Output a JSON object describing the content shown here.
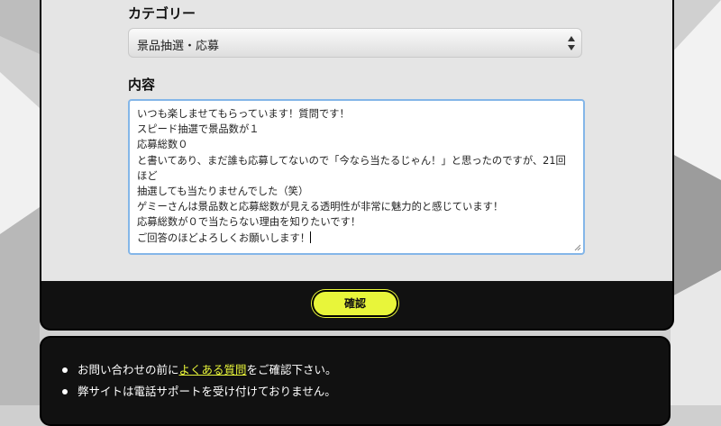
{
  "form": {
    "category_label": "カテゴリー",
    "category_value": "景品抽選・応募",
    "content_label": "内容",
    "content_lines": [
      "いつも楽しませてもらっています！質問です！",
      "スピード抽選で景品数が１",
      "応募総数０",
      "と書いてあり、まだ誰も応募してないので「今なら当たるじゃん！」と思ったのですが、21回ほど",
      "抽選しても当たりませんでした（笑）",
      "ゲミーさんは景品数と応募総数が見える透明性が非常に魅力的と感じています！",
      "応募総数が０で当たらない理由を知りたいです！",
      "ご回答のほどよろしくお願いします！"
    ],
    "confirm_label": "確認"
  },
  "notices": {
    "item1_before": "お問い合わせの前に",
    "item1_link": "よくある質問",
    "item1_after": "をご確認下さい。",
    "item2": "弊サイトは電話サポートを受け付けておりません。"
  },
  "colors": {
    "accent": "#e8f53a",
    "panel": "#e5e5e5",
    "card": "#111111",
    "textarea_border": "#84b6e8"
  },
  "icons": {
    "select_arrows": "select-arrows-icon",
    "bullet": "bullet-icon"
  }
}
